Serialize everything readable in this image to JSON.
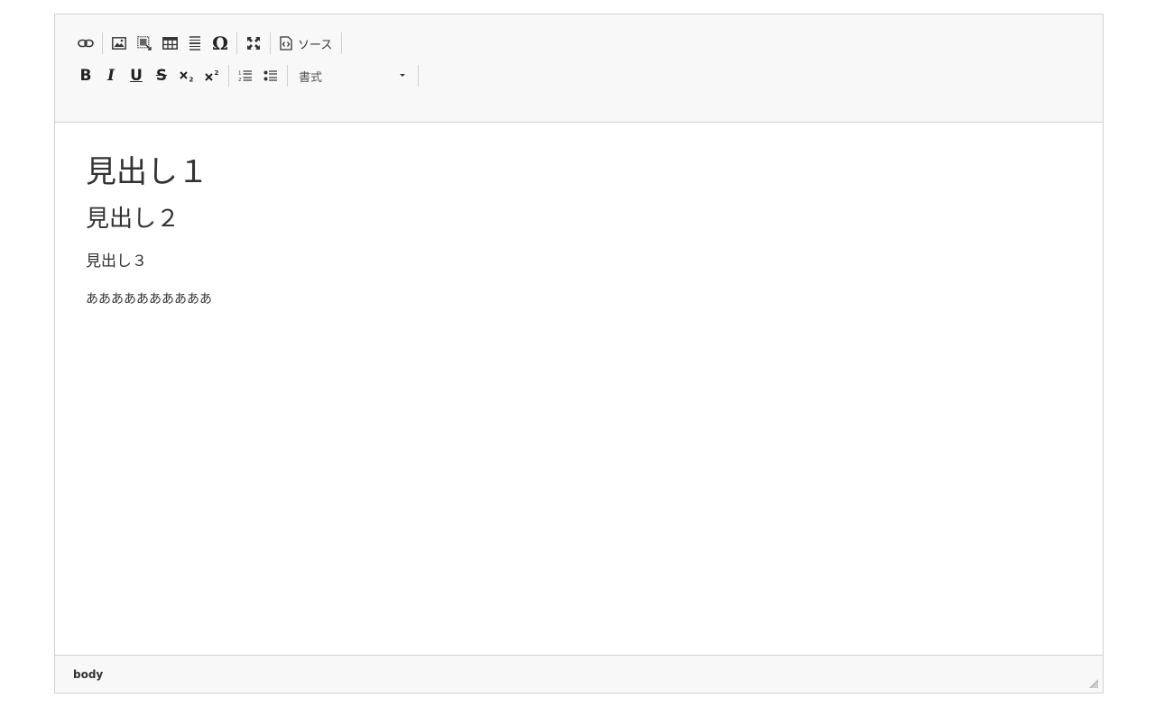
{
  "toolbar": {
    "row1": {
      "link": {
        "icon": "link-icon"
      },
      "image": {
        "icon": "image-icon"
      },
      "iframe": {
        "icon": "iframe-icon"
      },
      "table": {
        "icon": "table-icon"
      },
      "hr": {
        "icon": "horizontal-line-icon"
      },
      "special_char": {
        "icon": "omega-icon",
        "glyph": "Ω"
      },
      "maximize": {
        "icon": "maximize-icon"
      },
      "source": {
        "icon": "source-icon",
        "label": "ソース"
      }
    },
    "row2": {
      "bold": {
        "label": "B"
      },
      "italic": {
        "label": "I"
      },
      "underline": {
        "label": "U"
      },
      "strike": {
        "label": "S"
      },
      "subscript": {
        "icon": "subscript-icon"
      },
      "superscript": {
        "icon": "superscript-icon"
      },
      "numbered_list": {
        "icon": "numbered-list-icon"
      },
      "bulleted_list": {
        "icon": "bulleted-list-icon"
      },
      "format": {
        "label": "書式",
        "icon": "chevron-down-icon"
      }
    }
  },
  "content": {
    "h1": "見出し１",
    "h2": "見出し２",
    "h3": "見出し３",
    "paragraph": "ああああああああああ"
  },
  "statusbar": {
    "path": "body",
    "resize_icon": "resize-grip-icon"
  }
}
